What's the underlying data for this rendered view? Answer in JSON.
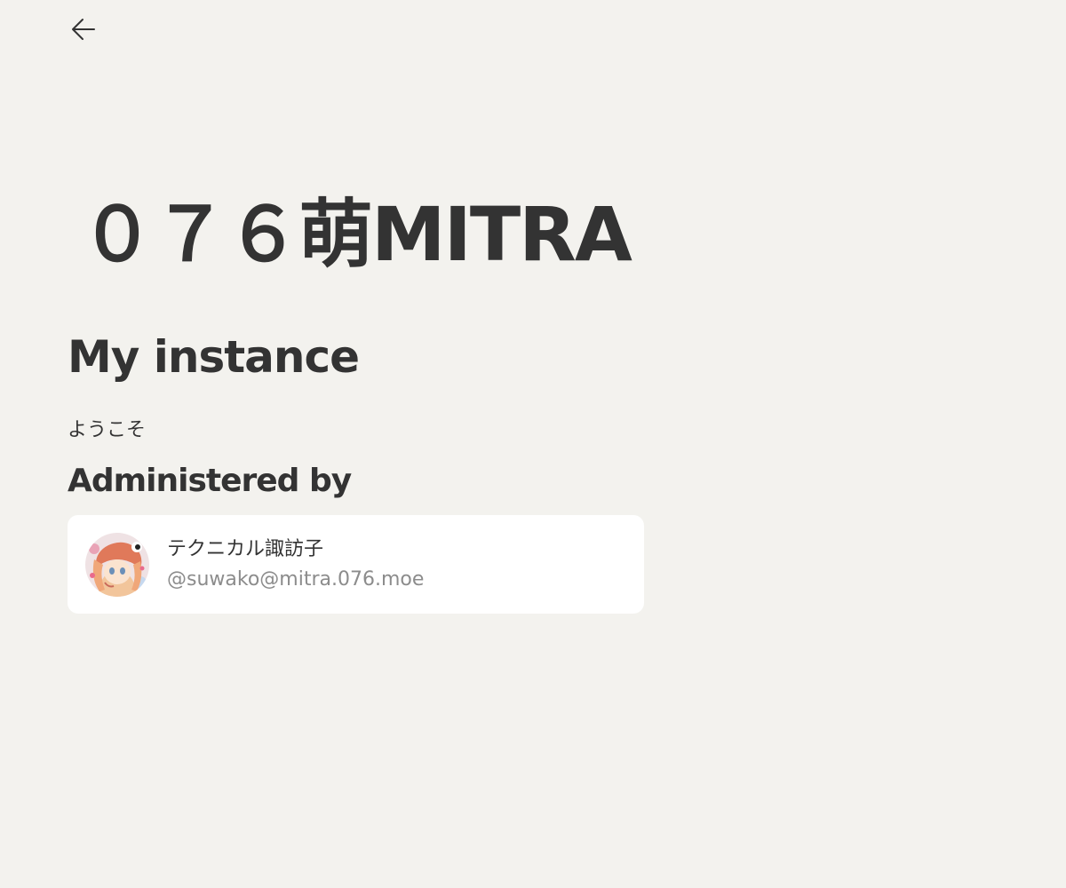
{
  "header": {
    "back_icon": "arrow-left-icon"
  },
  "site": {
    "title": "０７６萌MITRA"
  },
  "instance": {
    "heading": "My instance",
    "description": "ようこそ"
  },
  "admin": {
    "heading": "Administered by",
    "name": "テクニカル諏訪子",
    "handle": "@suwako@mitra.076.moe",
    "avatar_icon": "avatar-image"
  },
  "colors": {
    "background": "#f3f2ee",
    "card": "#ffffff",
    "text": "#333333",
    "muted": "#8c8c8c"
  }
}
